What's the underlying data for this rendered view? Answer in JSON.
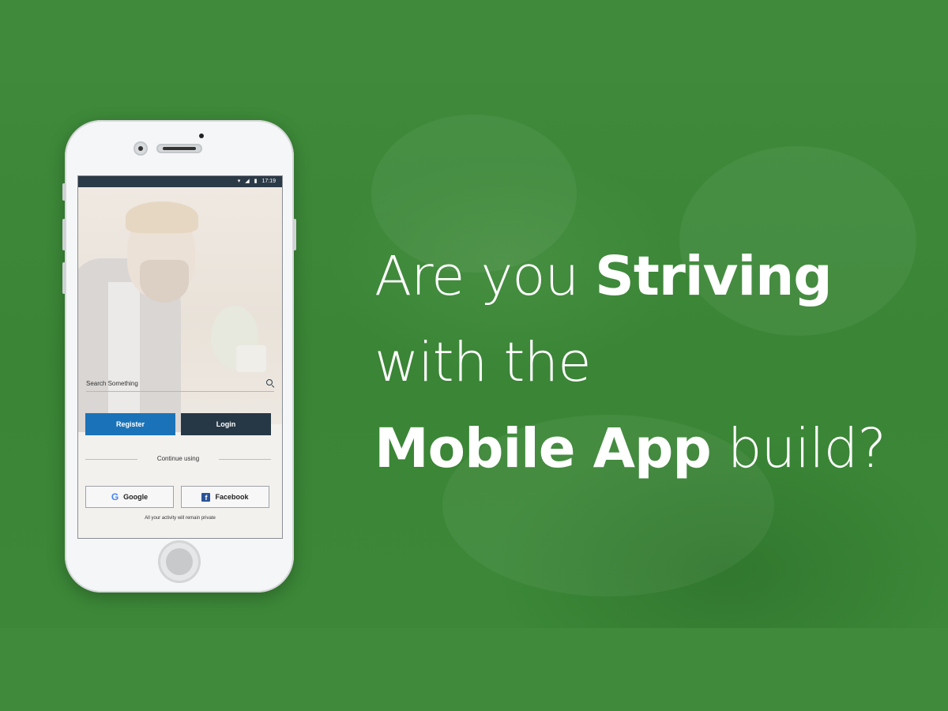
{
  "banner": {
    "headline": {
      "line1_light": "Are you ",
      "line1_bold": "Striving",
      "line2_light": "with the",
      "line3_bold": "Mobile App",
      "line3_light": " build?"
    },
    "colors": {
      "background": "#3f8a3b",
      "register": "#1a73b8",
      "login": "#263846"
    }
  },
  "app": {
    "status": {
      "time": "17:19",
      "icons": [
        "wifi-icon",
        "signal-icon",
        "battery-icon"
      ]
    },
    "search": {
      "placeholder": "Search Something",
      "icon": "search-icon"
    },
    "buttons": {
      "register": "Register",
      "login": "Login"
    },
    "continue_text": "Continue using",
    "social": {
      "google": "Google",
      "facebook": "Facebook"
    },
    "privacy": "All your activity will remain private"
  }
}
